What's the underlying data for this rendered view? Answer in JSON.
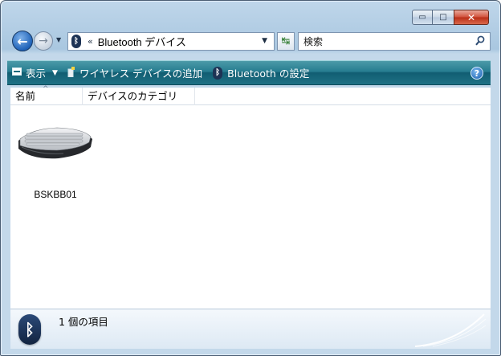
{
  "window": {
    "minimize_label": "▭",
    "maximize_label": "□",
    "close_label": "✕"
  },
  "nav": {
    "back_glyph": "←",
    "forward_glyph": "→",
    "address_chevron": "«",
    "address_text": "Bluetooth デバイス",
    "dropdown_glyph": "▼",
    "refresh_glyph": "↹",
    "search_placeholder": "検索"
  },
  "commandbar": {
    "view_label": "表示",
    "add_device_label": "ワイヤレス デバイスの追加",
    "bluetooth_settings_label": "Bluetooth の設定",
    "help_label": "?"
  },
  "columns": {
    "name": "名前",
    "category": "デバイスのカテゴリ"
  },
  "items": [
    {
      "name": "BSKBB01",
      "icon": "keyboard-icon"
    }
  ],
  "details": {
    "count_text": "1 個の項目",
    "icon": "bluetooth-icon"
  },
  "colors": {
    "commandbar_top": "#4b9aa8",
    "commandbar_bottom": "#115d72",
    "frame": "#a9c7e0",
    "close_button": "#c8432b"
  }
}
